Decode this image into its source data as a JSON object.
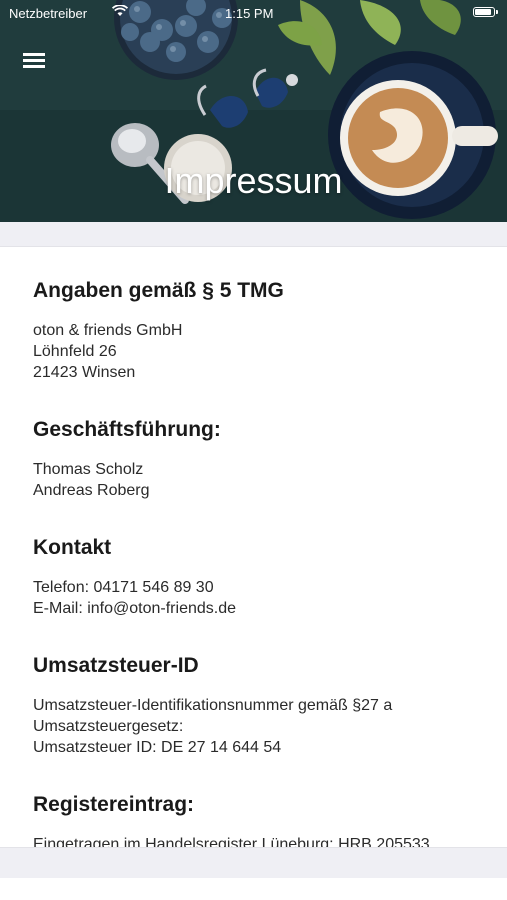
{
  "status_bar": {
    "carrier": "Netzbetreiber",
    "time": "1:15 PM",
    "wifi_icon": "wifi-icon",
    "battery_icon": "battery-icon"
  },
  "header": {
    "menu_icon": "hamburger-menu-icon",
    "title": "Impressum",
    "background": "photo of coffee cup, blueberries, spoon and hearing aids on dark green table"
  },
  "sections": [
    {
      "title": "Angaben gemäß § 5 TMG",
      "lines": [
        "oton & friends GmbH",
        "Löhnfeld 26",
        "21423 Winsen"
      ]
    },
    {
      "title": "Geschäftsführung:",
      "lines": [
        "Thomas Scholz",
        "Andreas Roberg"
      ]
    },
    {
      "title": "Kontakt",
      "lines": [
        "Telefon: 04171 546 89 30",
        "E-Mail: info@oton-friends.de"
      ]
    },
    {
      "title": "Umsatzsteuer-ID",
      "lines": [
        "Umsatzsteuer-Identifikationsnummer gemäß §27 a",
        "Umsatzsteuergesetz:",
        "Umsatzsteuer ID: DE 27 14 644 54"
      ]
    },
    {
      "title": "Registereintrag:",
      "lines": [
        "Eingetragen im Handelsregister Lüneburg: HRB 205533"
      ]
    }
  ],
  "colors": {
    "header_bg": "#1e3a3a",
    "band_bg": "#efeff4",
    "text": "#1f1f1f"
  }
}
